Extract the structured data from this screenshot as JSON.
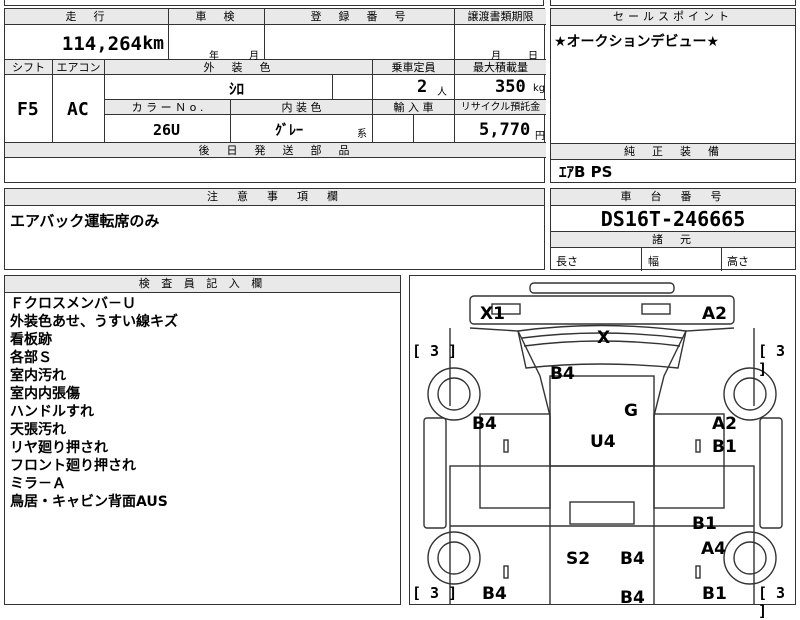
{
  "top_row": {
    "mileage_header": "走　行",
    "shaken_header": "車　検",
    "reg_header": "登　録　番　号",
    "transfer_header": "譲渡書類期限"
  },
  "mileage": {
    "value": "114,264",
    "unit": "km"
  },
  "shaken": {
    "year_unit": "年",
    "month_unit": "月"
  },
  "transfer": {
    "month_unit": "月",
    "day_unit": "日"
  },
  "spec_headers": {
    "shift": "シフト",
    "aircon": "エアコン",
    "exterior": "外　装　色",
    "capacity": "乗車定員",
    "max_load": "最大積載量",
    "color_no": "カ ラ ー Ｎ o .",
    "interior": "内 装 色",
    "import": "輸 入 車",
    "recycle": "リサイクル預託金"
  },
  "spec": {
    "shift": "F5",
    "aircon": "AC",
    "exterior_color": "ｼﾛ",
    "capacity": "2",
    "capacity_unit": "人",
    "max_load": "350",
    "max_load_unit": "kg",
    "color_no": "26U",
    "interior_color": "ｸﾞﾚｰ",
    "interior_suffix": "系",
    "recycle_fee": "5,770",
    "recycle_unit": "円"
  },
  "later_parts_header": "後　日　発　送　部　品",
  "sales_point": {
    "header": "セールスポイント",
    "text": "★オークションデビュー★"
  },
  "equipment": {
    "header": "純　正　装　備",
    "text": "ｴｱB PS"
  },
  "notes": {
    "header": "注　意　事　項　欄",
    "text": "エアバック運転席のみ"
  },
  "chassis": {
    "header": "車　台　番　号",
    "value": "DS16T-246665"
  },
  "dimensions": {
    "header": "諸　元",
    "length": "長さ",
    "width": "幅",
    "height": "高さ"
  },
  "inspector": {
    "header": "検 査 員 記 入 欄",
    "lines": [
      "Ｆクロスメンバ－Ｕ",
      "外装色あせ、うすい線キズ",
      "看板跡",
      "各部Ｓ",
      "室内汚れ",
      "室内内張傷",
      "ハンドルすれ",
      "天張汚れ",
      "リヤ廻り押され",
      "フロント廻り押され",
      "ミラ－Ａ",
      "鳥居・キャビン背面AUS"
    ]
  },
  "diagram": {
    "tire_label": "[ 3 ]",
    "marks": [
      "X1",
      "A2",
      "X",
      "B4",
      "G",
      "B4",
      "A2",
      "B1",
      "U4",
      "B1",
      "A4",
      "S2",
      "B4",
      "B4",
      "B4",
      "B1"
    ]
  }
}
